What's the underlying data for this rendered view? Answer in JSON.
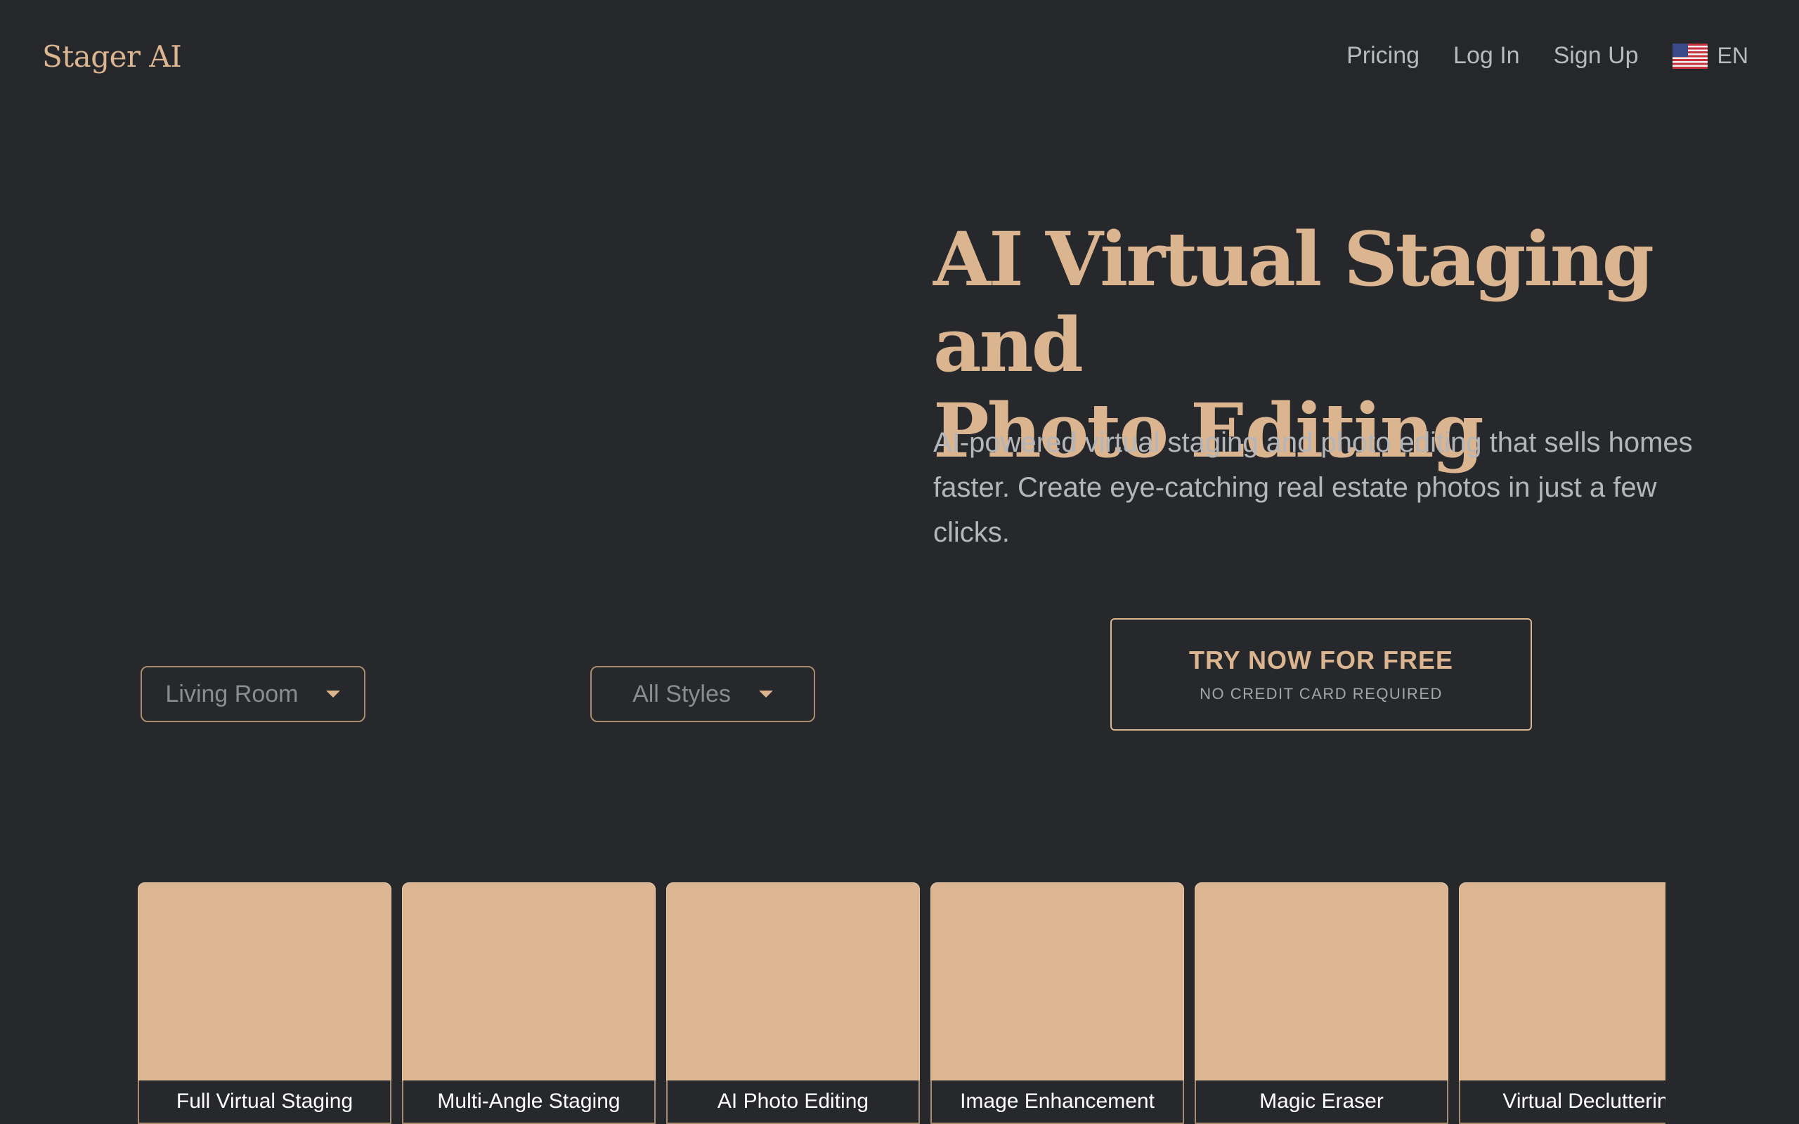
{
  "header": {
    "logo": "Stager AI",
    "nav": [
      "Pricing",
      "Log In",
      "Sign Up"
    ],
    "language": {
      "code": "EN",
      "flag_icon": "us-flag-icon"
    }
  },
  "hero": {
    "title_line1": "AI Virtual Staging and",
    "title_line2": "Photo Editing",
    "subtitle": "AI-powered virtual staging and photo editing that sells homes faster. Create eye-catching real estate photos in just a few clicks.",
    "room_select": "Living Room",
    "style_select": "All Styles",
    "cta_label": "TRY NOW FOR FREE",
    "cta_note": "NO CREDIT CARD REQUIRED"
  },
  "features": [
    "Full Virtual Staging",
    "Multi-Angle Staging",
    "AI Photo Editing",
    "Image Enhancement",
    "Magic Eraser",
    "Virtual Declutterin"
  ],
  "colors": {
    "background": "#26272b",
    "accent": "#dbb590",
    "muted_text": "#b4b6ba",
    "card_fill": "#dcb692"
  }
}
